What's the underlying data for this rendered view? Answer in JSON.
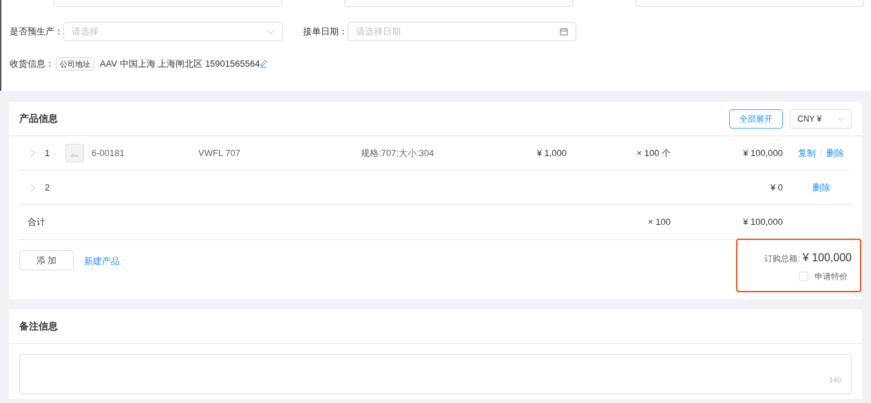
{
  "form": {
    "fields": [
      {
        "label": "是否预生产：",
        "kind": "select",
        "placeholder": "请选择"
      },
      {
        "label": "接单日期：",
        "kind": "date",
        "placeholder": "请选择日期"
      }
    ],
    "shipping": {
      "label": "收货信息：",
      "tag": "公司地址",
      "address": "AAV 中国上海 上海闸北区 15901565564"
    }
  },
  "products": {
    "title": "产品信息",
    "expand_button": "全部展开",
    "currency": "CNY ¥",
    "rows": [
      {
        "index": "1",
        "expanded": false,
        "code": "6-00181",
        "name": "VWFL 707",
        "spec": "规格:707;大小:304",
        "price": "¥ 1,000",
        "quantity": "× 100 个",
        "total": "¥ 100,000",
        "actions": [
          "复制",
          "删除"
        ]
      },
      {
        "index": "2",
        "expanded": false,
        "total": "¥ 0",
        "actions": [
          "删除"
        ]
      }
    ],
    "summary": {
      "label": "合计",
      "quantity": "× 100",
      "total": "¥ 100,000"
    },
    "add_button": "添 加",
    "new_product_link": "新建产品",
    "order_total": {
      "label": "订购总额:",
      "value": "¥ 100,000"
    },
    "special_price": {
      "label": "申请特价",
      "checked": false
    }
  },
  "remarks": {
    "title": "备注信息",
    "counter": "140"
  }
}
